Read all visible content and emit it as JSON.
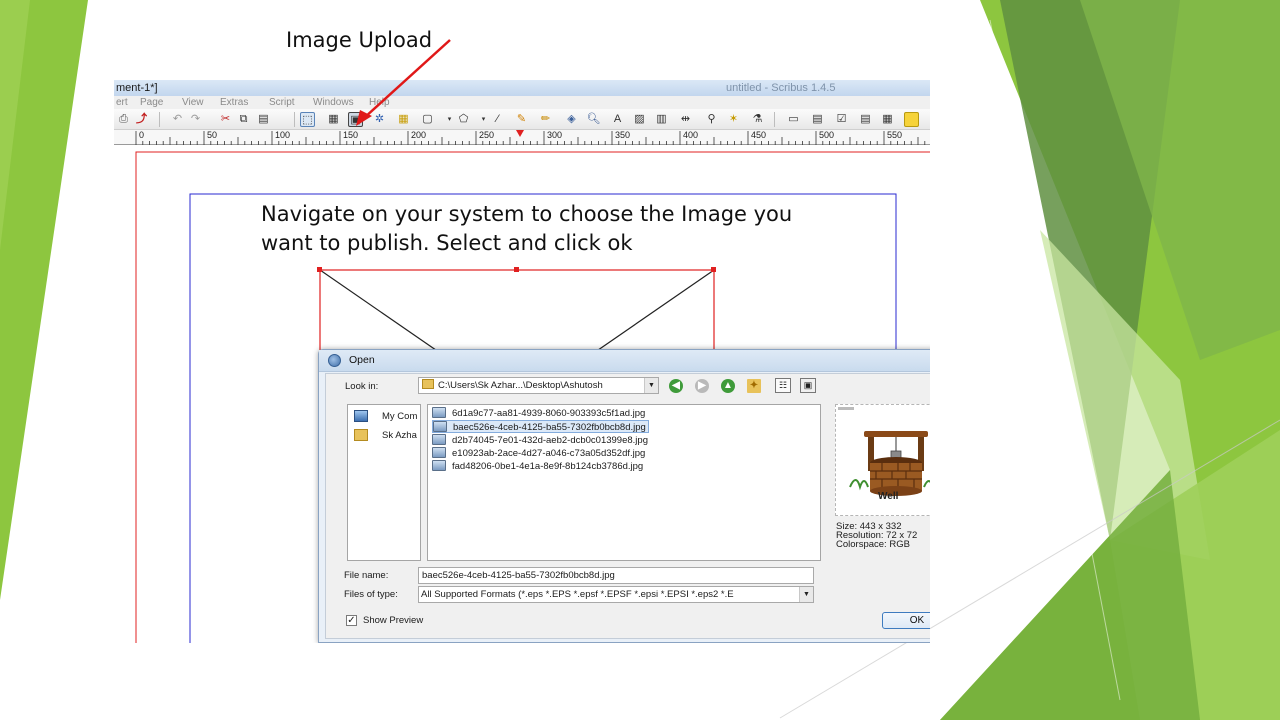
{
  "slide": {
    "caption_upload": "Image Upload",
    "caption_nav_line1": "Navigate on your system to choose the Image you",
    "caption_nav_line2": "want to publish. Select and click ok",
    "colors": {
      "green_light": "#8dc63f",
      "green_mid": "#6da83a",
      "green_dark": "#5e8e3e",
      "arrow": "#e01818"
    }
  },
  "app": {
    "title": "ment-1*]",
    "window_title": "untitled - Scribus 1.4.5",
    "menu": [
      "ert",
      "Page",
      "View",
      "Extras",
      "Script",
      "Windows",
      "Help"
    ],
    "ruler_labels": [
      "0",
      "50",
      "100",
      "150",
      "200",
      "250",
      "300",
      "350",
      "400",
      "450",
      "500",
      "550"
    ],
    "toolbar_icons": [
      "print-icon",
      "pdf-icon",
      "undo-icon",
      "redo-icon",
      "cut-icon",
      "copy-icon",
      "paste-icon",
      "select-icon",
      "text-frame-icon",
      "image-frame-icon",
      "render-frame-icon",
      "table-icon",
      "shape-icon",
      "polygon-icon",
      "line-icon",
      "bezier-icon",
      "freehand-icon",
      "rotate-icon",
      "zoom-icon",
      "edit-text-icon",
      "link-frames-icon",
      "unlink-frames-icon",
      "measure-icon",
      "copy-props-icon",
      "eyedropper-icon",
      "pdf-button-icon",
      "pdf-text-field-icon",
      "pdf-checkbox-icon",
      "pdf-combo-icon",
      "pdf-list-icon",
      "pdf-annotation-icon"
    ]
  },
  "dialog": {
    "title": "Open",
    "look_in_label": "Look in:",
    "look_in_value": "C:\\Users\\Sk Azhar...\\Desktop\\Ashutosh",
    "places": [
      "My Com",
      "Sk Azha"
    ],
    "files": [
      "6d1a9c77-aa81-4939-8060-903393c5f1ad.jpg",
      "baec526e-4ceb-4125-ba55-7302fb0bcb8d.jpg",
      "d2b74045-7e01-432d-aeb2-dcb0c01399e8.jpg",
      "e10923ab-2ace-4d27-a046-c73a05d352df.jpg",
      "fad48206-0be1-4e1a-8e9f-8b124cb3786d.jpg"
    ],
    "selected_file_index": 1,
    "file_name_label": "File name:",
    "file_name_value": "baec526e-4ceb-4125-ba55-7302fb0bcb8d.jpg",
    "file_type_label": "Files of type:",
    "file_type_value": "All Supported Formats (*.eps *.EPS *.epsf *.EPSF *.epsi *.EPSI *.eps2 *.E",
    "preview_caption": "Well",
    "preview_size": "Size: 443 x 332",
    "preview_resolution": "Resolution: 72 x 72",
    "preview_colorspace": "Colorspace: RGB",
    "show_preview_label": "Show Preview",
    "show_preview_checked": true,
    "ok_label": "OK"
  }
}
